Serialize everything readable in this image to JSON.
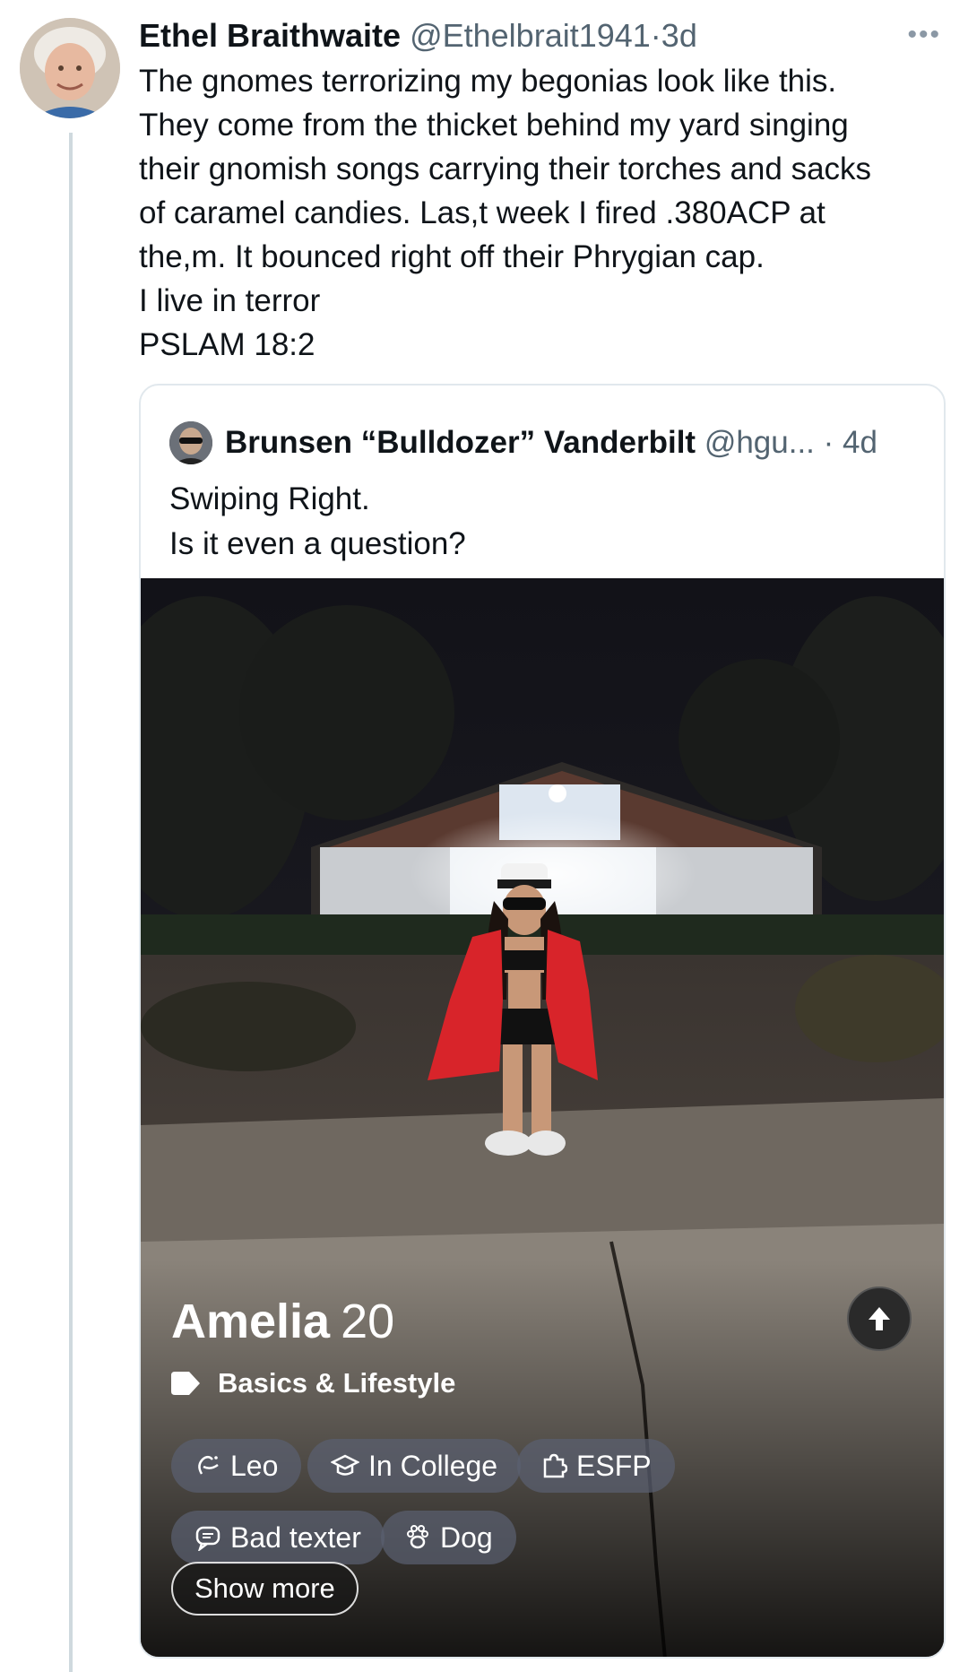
{
  "tweet": {
    "author_name": "Ethel Braithwaite",
    "handle": "@Ethelbrait1941",
    "separator": "·",
    "time": "3d",
    "more_icon": "more-dots-icon",
    "lines": [
      "The gnomes terrorizing my begonias look like this.",
      "They come from the thicket behind my yard singing",
      "their gnomish songs carrying their torches and sacks",
      "of caramel candies. Las,t week I fired .380ACP at",
      "the,m. It bounced right off their Phrygian cap.",
      "I live in terror",
      "PSLAM 18:2"
    ]
  },
  "quote": {
    "author_name": "Brunsen “Bulldozer” Vanderbilt",
    "handle": "@hgu...",
    "separator": "·",
    "time": "4d",
    "lines": [
      "Swiping Right.",
      "Is it even a question?"
    ]
  },
  "profile": {
    "name": "Amelia",
    "age": "20",
    "section_label": "Basics & Lifestyle",
    "chips": [
      {
        "label": "Leo",
        "icon": "zodiac-icon"
      },
      {
        "label": "In College",
        "icon": "graduation-cap-icon"
      },
      {
        "label": "ESFP",
        "icon": "puzzle-icon"
      },
      {
        "label": "Bad texter",
        "icon": "chat-bubble-icon"
      },
      {
        "label": "Dog",
        "icon": "paw-icon"
      }
    ],
    "show_more_label": "Show more"
  },
  "colors": {
    "text": "#0f1419",
    "muted": "#536471",
    "border": "#e1e8ed",
    "robe_red": "#d8242a"
  }
}
